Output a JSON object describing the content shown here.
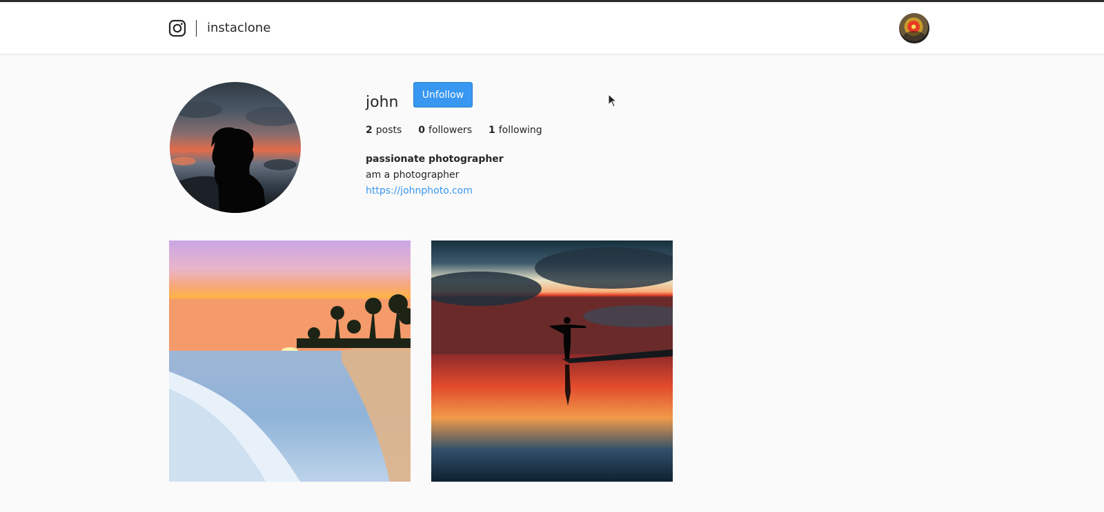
{
  "app": {
    "name": "instaclone"
  },
  "icons": {
    "brand": "instagram-icon",
    "nav_avatar": "user-avatar",
    "profile_avatar": "profile-avatar-image"
  },
  "colors": {
    "accent": "#3897f0",
    "link": "#3897f0",
    "text": "#262626",
    "page_background": "#fafafa"
  },
  "profile": {
    "username": "john",
    "action_button": "Unfollow",
    "stats": [
      {
        "count": "2",
        "label": "posts"
      },
      {
        "count": "0",
        "label": "followers"
      },
      {
        "count": "1",
        "label": "following"
      }
    ],
    "bio_name": "passionate photographer",
    "bio_text": "am a photographer",
    "website": "https://johnphoto.com"
  },
  "posts": [
    {
      "subject": "beach sunset with palm trees"
    },
    {
      "subject": "silhouette with outstretched arms at sunset reflection"
    }
  ]
}
